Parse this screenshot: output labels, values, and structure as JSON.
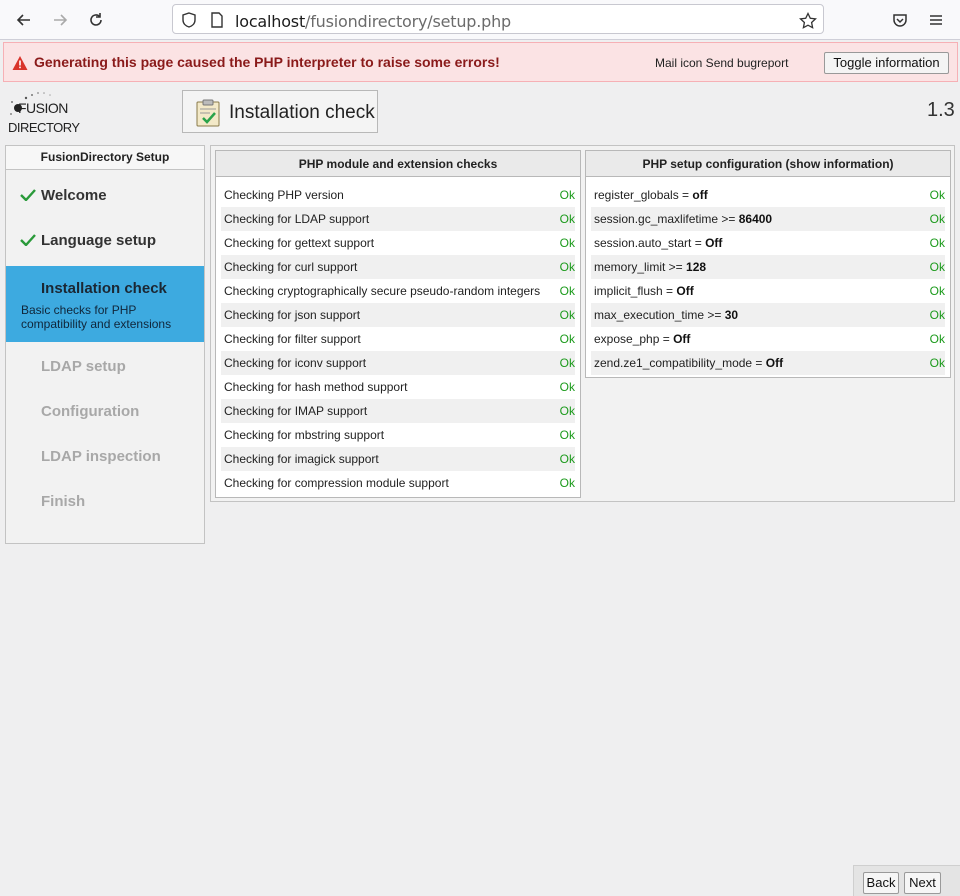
{
  "browser": {
    "url_host": "localhost",
    "url_path": "/fusiondirectory/setup.php"
  },
  "error_banner": {
    "message": "Generating this page caused the PHP interpreter to raise some errors!",
    "mail_label": "Mail icon Send bugreport",
    "toggle_label": "Toggle information"
  },
  "header": {
    "logo_line1": "FUSION",
    "logo_line2": "DIRECTORY",
    "title": "Installation check",
    "version": "1.3"
  },
  "sidebar": {
    "title": "FusionDirectory Setup",
    "steps": [
      {
        "label": "Welcome",
        "state": "done"
      },
      {
        "label": "Language setup",
        "state": "done"
      },
      {
        "label": "Installation check",
        "state": "active",
        "description": "Basic checks for PHP compatibility and extensions"
      },
      {
        "label": "LDAP setup",
        "state": "todo"
      },
      {
        "label": "Configuration",
        "state": "todo"
      },
      {
        "label": "LDAP inspection",
        "state": "todo"
      },
      {
        "label": "Finish",
        "state": "todo"
      }
    ]
  },
  "modules_panel": {
    "title": "PHP module and extension checks",
    "rows": [
      {
        "label": "Checking PHP version",
        "status": "Ok"
      },
      {
        "label": "Checking for LDAP support",
        "status": "Ok"
      },
      {
        "label": "Checking for gettext support",
        "status": "Ok"
      },
      {
        "label": "Checking for curl support",
        "status": "Ok"
      },
      {
        "label": "Checking cryptographically secure pseudo-random integers",
        "status": "Ok"
      },
      {
        "label": "Checking for json support",
        "status": "Ok"
      },
      {
        "label": "Checking for filter support",
        "status": "Ok"
      },
      {
        "label": "Checking for iconv support",
        "status": "Ok"
      },
      {
        "label": "Checking for hash method support",
        "status": "Ok"
      },
      {
        "label": "Checking for IMAP support",
        "status": "Ok"
      },
      {
        "label": "Checking for mbstring support",
        "status": "Ok"
      },
      {
        "label": "Checking for imagick support",
        "status": "Ok"
      },
      {
        "label": "Checking for compression module support",
        "status": "Ok"
      }
    ]
  },
  "config_panel": {
    "title": "PHP setup configuration (show information)",
    "rows": [
      {
        "key": "register_globals = ",
        "value": "off",
        "status": "Ok"
      },
      {
        "key": "session.gc_maxlifetime >= ",
        "value": "86400",
        "status": "Ok"
      },
      {
        "key": "session.auto_start = ",
        "value": "Off",
        "status": "Ok"
      },
      {
        "key": "memory_limit >= ",
        "value": "128",
        "status": "Ok"
      },
      {
        "key": "implicit_flush = ",
        "value": "Off",
        "status": "Ok"
      },
      {
        "key": "max_execution_time >= ",
        "value": "30",
        "status": "Ok"
      },
      {
        "key": "expose_php = ",
        "value": "Off",
        "status": "Ok"
      },
      {
        "key": "zend.ze1_compatibility_mode = ",
        "value": "Off",
        "status": "Ok"
      }
    ]
  },
  "footer": {
    "back_label": "Back",
    "next_label": "Next"
  },
  "colors": {
    "active_step": "#3daae0",
    "ok_green": "#1b9a1b",
    "error_bg": "#fbe3e4",
    "error_text": "#8a1a1a"
  },
  "icons": [
    "back-arrow-icon",
    "forward-arrow-icon",
    "reload-icon",
    "shield-icon",
    "page-icon",
    "bookmark-star-icon",
    "pocket-icon",
    "menu-icon",
    "warning-icon",
    "check-icon",
    "clipboard-check-icon"
  ]
}
